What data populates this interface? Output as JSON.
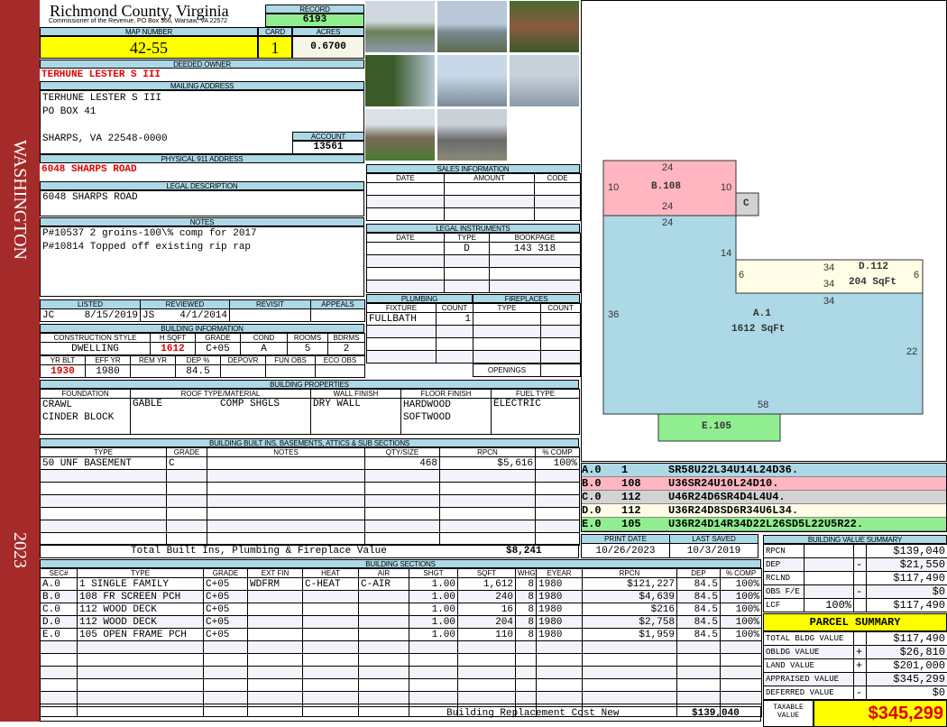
{
  "sidebar": {
    "district": "WASHINGTON",
    "year": "2023"
  },
  "header": {
    "county": "Richmond County, Virginia",
    "office": "Commissioner of the Revenue, PO Box 366, Warsaw, VA 22572",
    "record_label": "RECORD",
    "record": "6193",
    "map_label": "MAP NUMBER",
    "map": "42-55",
    "card_label": "CARD",
    "card": "1",
    "acres_label": "ACRES",
    "acres": "0.6700"
  },
  "owner": {
    "deeded_label": "DEEDED OWNER",
    "deeded": "TERHUNE LESTER S III",
    "mailing_label": "MAILING ADDRESS",
    "line1": "TERHUNE LESTER S III",
    "line2": "PO BOX 41",
    "line3": "SHARPS, VA 22548-0000",
    "account_label": "ACCOUNT",
    "account": "13561",
    "physical_label": "PHYSICAL 911 ADDRESS",
    "physical": "6048 SHARPS ROAD",
    "legal_label": "LEGAL DESCRIPTION",
    "legal": "6048 SHARPS ROAD",
    "notes_label": "NOTES",
    "note1": "P#10537 2 groins-100\\% comp for 2017",
    "note2": "P#10814 Topped off existing rip rap"
  },
  "review": {
    "headers": [
      "LISTED",
      "REVIEWED",
      "REVISIT",
      "APPEALS"
    ],
    "listed_by": "JC",
    "listed": "8/15/2019",
    "reviewed_by": "JS",
    "reviewed": "4/1/2014"
  },
  "building_info": {
    "title": "BUILDING INFORMATION",
    "h1": [
      "CONSTRUCTION STYLE",
      "H SQFT",
      "GRADE",
      "COND",
      "ROOMS",
      "BDRMS"
    ],
    "r1": [
      "DWELLING",
      "1612",
      "C+05",
      "A",
      "5",
      "2"
    ],
    "h2": [
      "YR BLT",
      "EFF YR",
      "REM YR",
      "DEP %",
      "DEPOVR",
      "FUN OBS",
      "ECO OBS"
    ],
    "r2": [
      "1930",
      "1980",
      "",
      "84.5",
      "",
      "",
      ""
    ]
  },
  "properties": {
    "title": "BUILDING PROPERTIES",
    "headers": [
      "FOUNDATION",
      "ROOF TYPE/MATERIAL",
      "WALL FINISH",
      "FLOOR FINISH",
      "FUEL TYPE"
    ],
    "foundation": [
      "CRAWL",
      "CINDER BLOCK"
    ],
    "roof_type": "GABLE",
    "roof_material": "COMP SHGLS",
    "wall": "DRY WALL",
    "floor": [
      "HARDWOOD",
      "SOFTWOOD"
    ],
    "fuel": "ELECTRIC"
  },
  "builtins": {
    "title": "BUILDING BUILT INS, BASEMENTS, ATTICS & SUB SECTIONS",
    "headers": [
      "TYPE",
      "GRADE",
      "NOTES",
      "QTY/SIZE",
      "RPCN",
      "% COMP"
    ],
    "rows": [
      [
        "50 UNF BASEMENT",
        "C",
        "",
        "468",
        "$5,616",
        "100%"
      ]
    ],
    "total_label": "Total Built Ins, Plumbing & Fireplace Value",
    "total": "$8,241"
  },
  "sales": {
    "title": "SALES INFORMATION",
    "headers": [
      "DATE",
      "AMOUNT",
      "CODE"
    ]
  },
  "instruments": {
    "title": "LEGAL INSTRUMENTS",
    "headers": [
      "DATE",
      "TYPE",
      "BOOKPAGE"
    ],
    "rows": [
      [
        "",
        "D",
        "143 318"
      ]
    ]
  },
  "plumbing": {
    "title": "PLUMBING",
    "headers": [
      "FIXTURE",
      "COUNT"
    ],
    "rows": [
      [
        "FULLBATH",
        "1"
      ]
    ]
  },
  "fireplaces": {
    "title": "FIREPLACES",
    "headers": [
      "TYPE",
      "COUNT"
    ],
    "openings_label": "OPENINGS"
  },
  "sketch": {
    "b_label": "B.108",
    "c_label": "C",
    "d_label": "D.112",
    "d_area": "204 SqFt",
    "a_label": "A.1",
    "a_area": "1612 SqFt",
    "e_label": "E.105",
    "dims": {
      "b_top": "24",
      "b_left": "10",
      "b_right": "10",
      "b_bottom": "24",
      "a_top": "24",
      "a_14": "14",
      "d_left": "6",
      "d_right": "6",
      "d_top": "34",
      "d_bottom": "34",
      "a_34": "34",
      "a_left": "36",
      "a_right": "22",
      "a_bottom": "58"
    }
  },
  "legend": [
    {
      "sec": "A.0",
      "code": "1",
      "path": "SR58U22L34U14L24D36.",
      "color": "#add8e6"
    },
    {
      "sec": "B.0",
      "code": "108",
      "path": "U36SR24U10L24D10.",
      "color": "#ffb6c1"
    },
    {
      "sec": "C.0",
      "code": "112",
      "path": "U46R24D6SR4D4L4U4.",
      "color": "#d3d3d3"
    },
    {
      "sec": "D.0",
      "code": "112",
      "path": "U36R24D8SD6R34U6L34.",
      "color": "#fffde6"
    },
    {
      "sec": "E.0",
      "code": "105",
      "path": "U36R24D14R34D22L26SD5L22U5R22.",
      "color": "#90ee90"
    }
  ],
  "dates": {
    "print_label": "PRINT DATE",
    "print": "10/26/2023",
    "saved_label": "LAST SAVED",
    "saved": "10/3/2019"
  },
  "sections": {
    "title": "BUILDING SECTIONS",
    "headers": [
      "SEC#",
      "TYPE",
      "GRADE",
      "EXT FIN",
      "HEAT",
      "AIR",
      "SHGT",
      "SQFT",
      "WHGT",
      "EYEAR",
      "RPCN",
      "DEP",
      "% COMP"
    ],
    "rows": [
      [
        "A.0",
        "1 SINGLE FAMILY",
        "C+05",
        "WDFRM",
        "C-HEAT",
        "C-AIR",
        "1.00",
        "1,612",
        "8",
        "1980",
        "$121,227",
        "84.5",
        "100%"
      ],
      [
        "B.0",
        "108 FR SCREEN PCH",
        "C+05",
        "",
        "",
        "",
        "1.00",
        "240",
        "8",
        "1980",
        "$4,639",
        "84.5",
        "100%"
      ],
      [
        "C.0",
        "112 WOOD DECK",
        "C+05",
        "",
        "",
        "",
        "1.00",
        "16",
        "8",
        "1980",
        "$216",
        "84.5",
        "100%"
      ],
      [
        "D.0",
        "112 WOOD DECK",
        "C+05",
        "",
        "",
        "",
        "1.00",
        "204",
        "8",
        "1980",
        "$2,758",
        "84.5",
        "100%"
      ],
      [
        "E.0",
        "105 OPEN FRAME PCH",
        "C+05",
        "",
        "",
        "",
        "1.00",
        "110",
        "8",
        "1980",
        "$1,959",
        "84.5",
        "100%"
      ]
    ],
    "total_label": "Building Replacement Cost New",
    "total": "$139,040"
  },
  "value_summary": {
    "title": "BUILDING VALUE SUMMARY",
    "rows": [
      [
        "RPCN",
        "",
        "",
        "$139,040"
      ],
      [
        "DEP",
        "",
        "-",
        "$21,550"
      ],
      [
        "RCLND",
        "",
        "",
        "$117,490"
      ],
      [
        "OBS F/E",
        "",
        "-",
        "$0"
      ],
      [
        "LCF",
        "100%",
        "",
        "$117,490"
      ]
    ]
  },
  "parcel": {
    "title": "PARCEL SUMMARY",
    "rows": [
      [
        "TOTAL BLDG VALUE",
        "",
        "$117,490"
      ],
      [
        "OBLDG VALUE",
        "+",
        "$26,810"
      ],
      [
        "LAND VALUE",
        "+",
        "$201,000"
      ],
      [
        "APPRAISED VALUE",
        "",
        "$345,299"
      ],
      [
        "DEFERRED VALUE",
        "-",
        "$0"
      ]
    ],
    "taxable_label": "TAXABLE VALUE",
    "taxable": "$345,299"
  },
  "colors": {
    "label_bg": "#add8e6",
    "highlight": "#ffff00",
    "record": "#90ee90",
    "sidebar": "#a52a2a"
  }
}
